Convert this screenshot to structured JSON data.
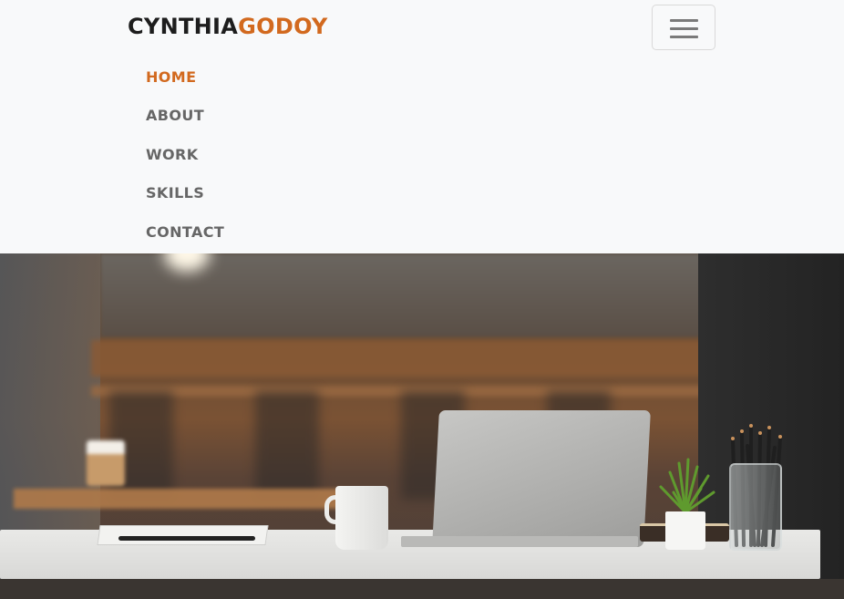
{
  "brand": {
    "part1": "CYNTHIA",
    "part2": "GODOY"
  },
  "colors": {
    "accent": "#d2691e",
    "nav_text": "#666666",
    "navbar_bg": "#f8f9fa"
  },
  "toggler": {
    "icon": "hamburger-menu-icon"
  },
  "nav": {
    "items": [
      {
        "label": "HOME",
        "active": true
      },
      {
        "label": "ABOUT",
        "active": false
      },
      {
        "label": "WORK",
        "active": false
      },
      {
        "label": "SKILLS",
        "active": false
      },
      {
        "label": "CONTACT",
        "active": false
      }
    ]
  },
  "hero": {
    "image": "workspace-desk-photo"
  }
}
